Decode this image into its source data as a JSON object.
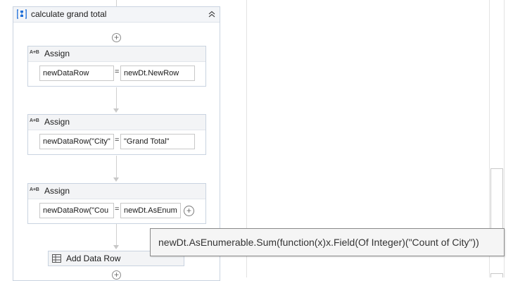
{
  "sequence": {
    "title": "calculate grand total",
    "icon": "sequence-icon",
    "collapse_icon": "collapse-chevron-icon"
  },
  "activities": [
    {
      "badge": "A+B",
      "title": "Assign",
      "to": "newDataRow",
      "eq": "=",
      "value": "newDt.NewRow"
    },
    {
      "badge": "A+B",
      "title": "Assign",
      "to": "newDataRow(\"City\"",
      "eq": "=",
      "value": "\"Grand Total\""
    },
    {
      "badge": "A+B",
      "title": "Assign",
      "to": "newDataRow(\"Cou",
      "eq": "=",
      "value": "newDt.AsEnum"
    }
  ],
  "add_data_row": {
    "title": "Add Data Row",
    "icon": "data-table-icon"
  },
  "tooltip": {
    "text": "newDt.AsEnumerable.Sum(function(x)x.Field(Of Integer)(\"Count of City\"))"
  },
  "colors": {
    "border": "#c9d3e0",
    "header_bg": "#f3f5f8",
    "connector": "#d0d0d0",
    "accent": "#1e6fd9"
  }
}
